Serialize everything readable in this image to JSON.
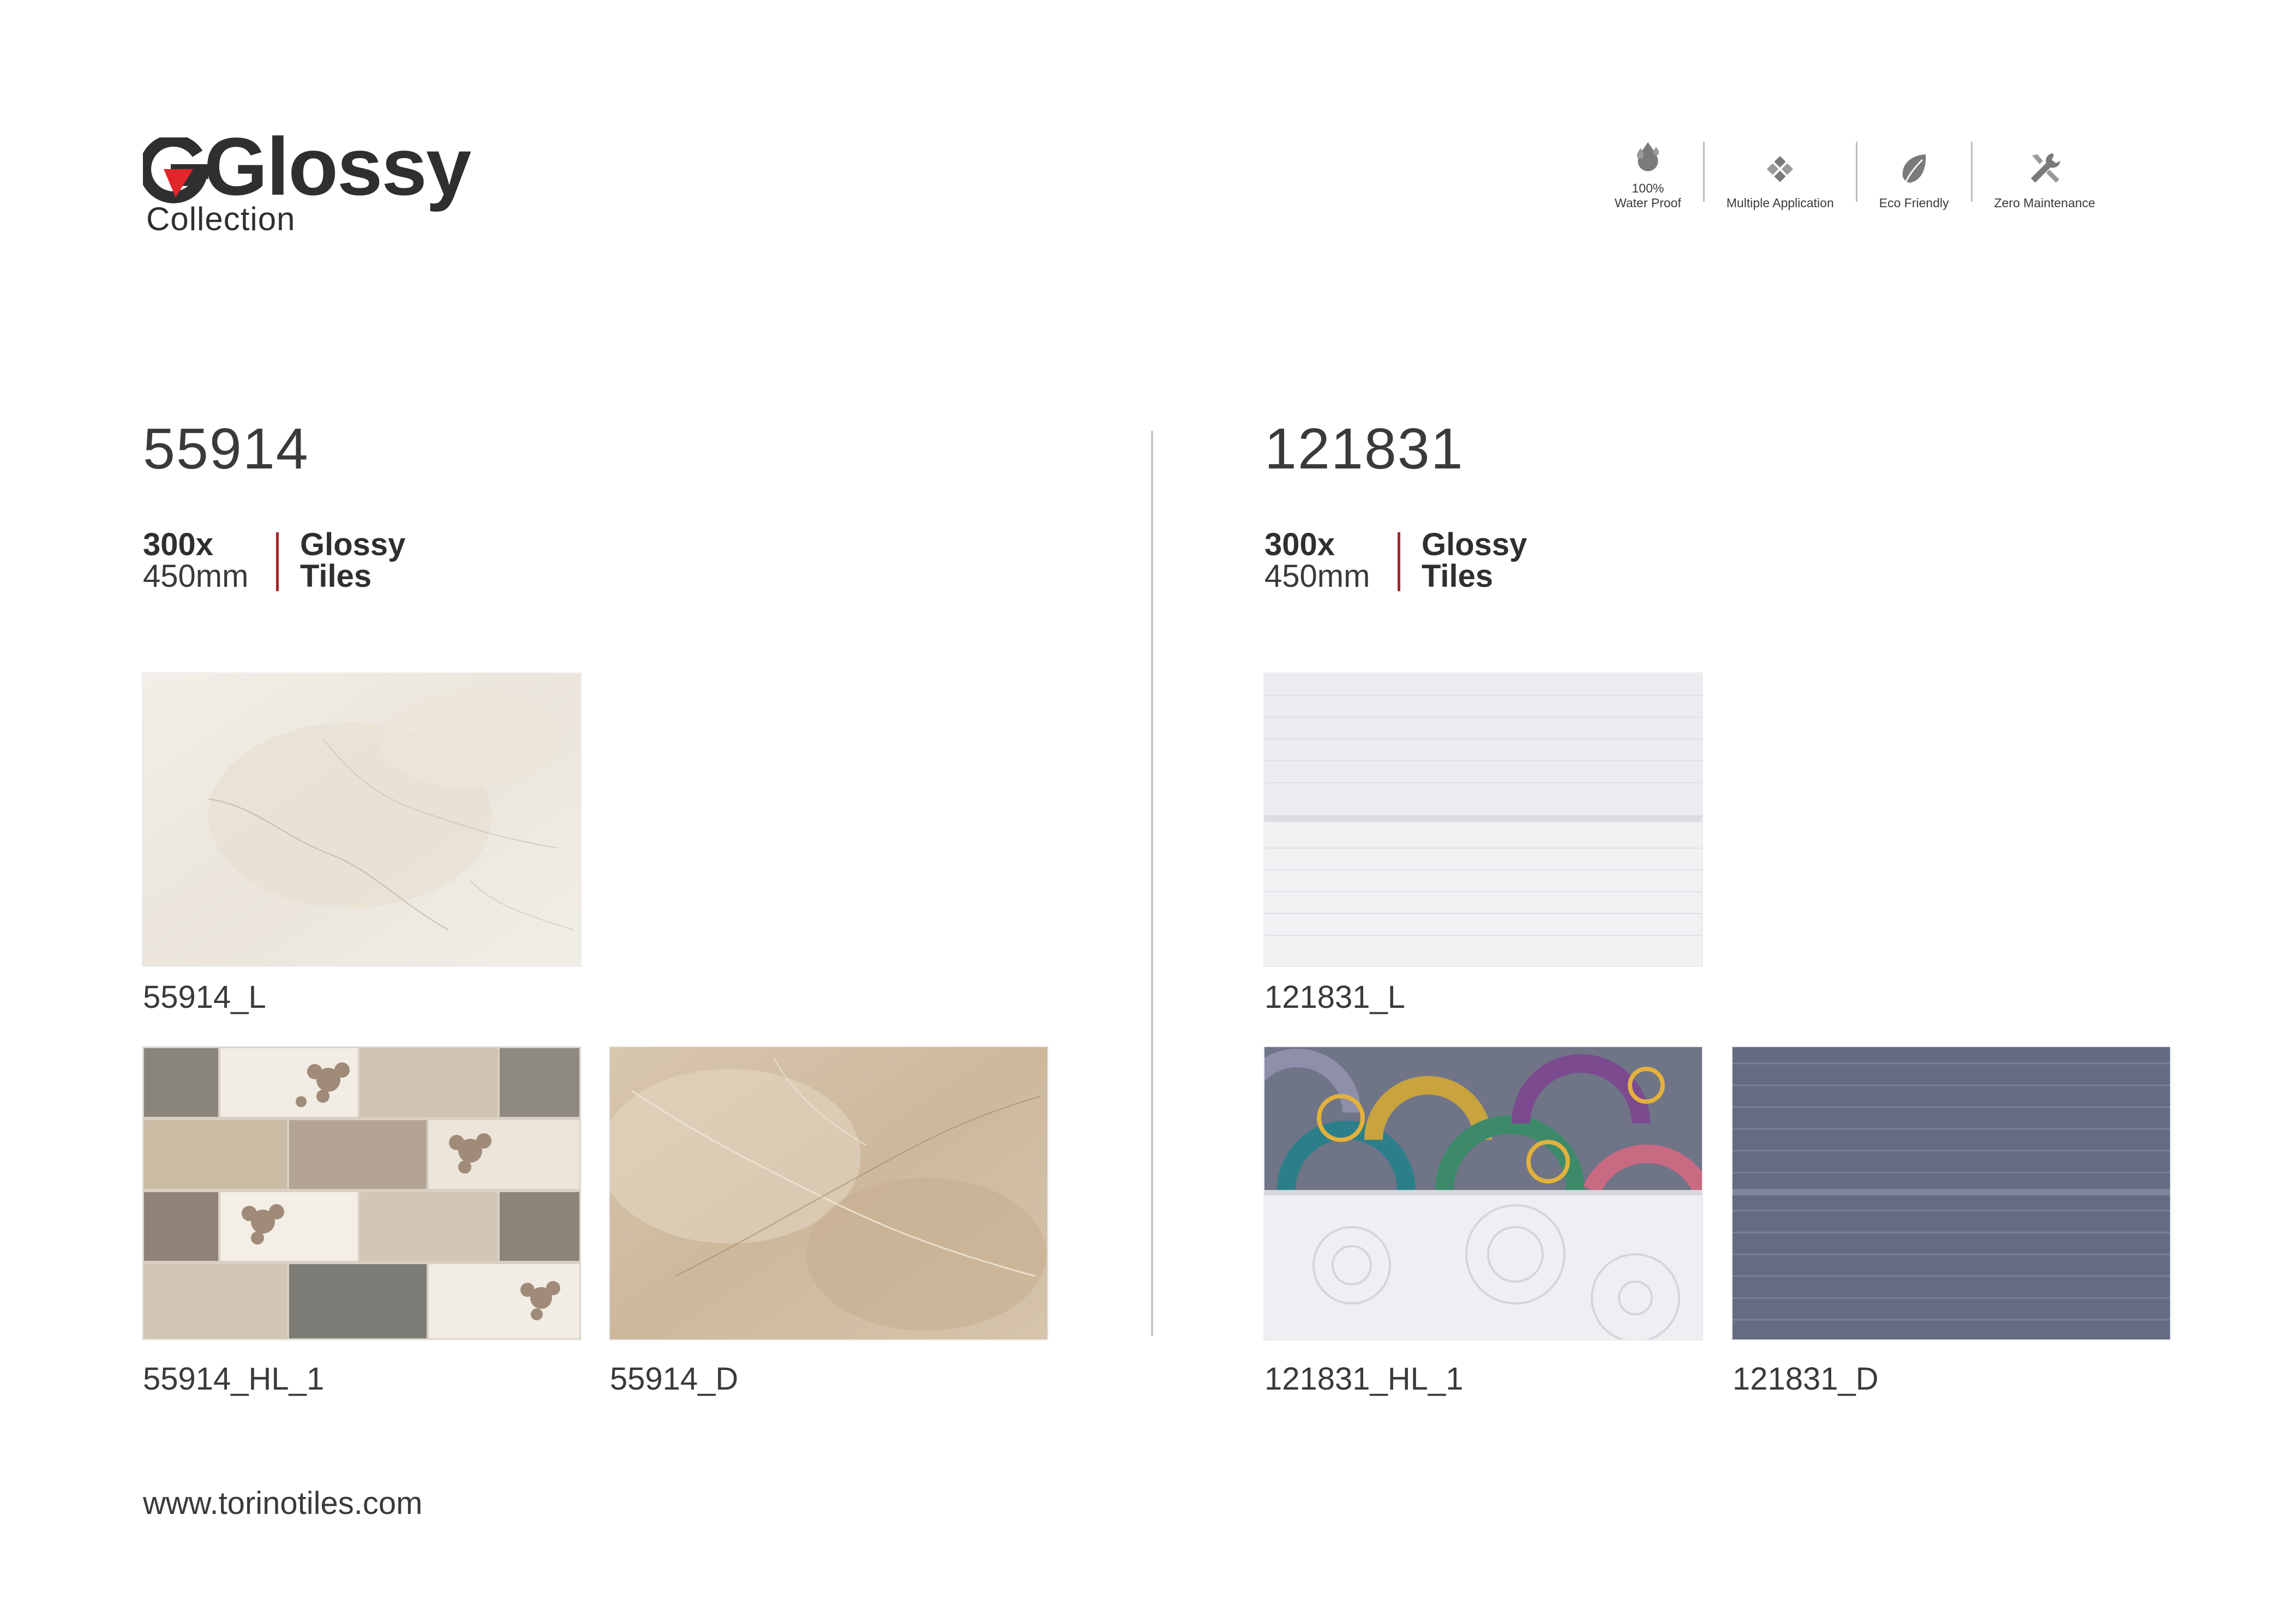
{
  "brand": {
    "logo_text": "Glossy",
    "logo_subtitle": "Collection",
    "accent_color": "#e0262b"
  },
  "features": [
    {
      "icon": "water-drop-icon",
      "label_line1": "100%",
      "label_line2": "Water Proof"
    },
    {
      "icon": "tiles-grid-icon",
      "label_line1": "",
      "label_line2": "Multiple Application"
    },
    {
      "icon": "leaf-icon",
      "label_line1": "",
      "label_line2": "Eco Friendly"
    },
    {
      "icon": "wrench-icon",
      "label_line1": "",
      "label_line2": "Zero Maintenance"
    }
  ],
  "products": [
    {
      "code": "55914",
      "size_line1": "300x",
      "size_line2": "450mm",
      "finish_line1": "Glossy",
      "finish_line2": "Tiles",
      "tiles": [
        {
          "label": "55914_L"
        },
        {
          "label": "55914_HL_1"
        },
        {
          "label": "55914_D"
        }
      ]
    },
    {
      "code": "121831",
      "size_line1": "300x",
      "size_line2": "450mm",
      "finish_line1": "Glossy",
      "finish_line2": "Tiles",
      "tiles": [
        {
          "label": "121831_L"
        },
        {
          "label": "121831_HL_1"
        },
        {
          "label": "121831_D"
        }
      ]
    }
  ],
  "footer": {
    "website": "www.torinotiles.com"
  },
  "colors": {
    "divider_red": "#a6262a",
    "text": "#3a3a3a"
  }
}
